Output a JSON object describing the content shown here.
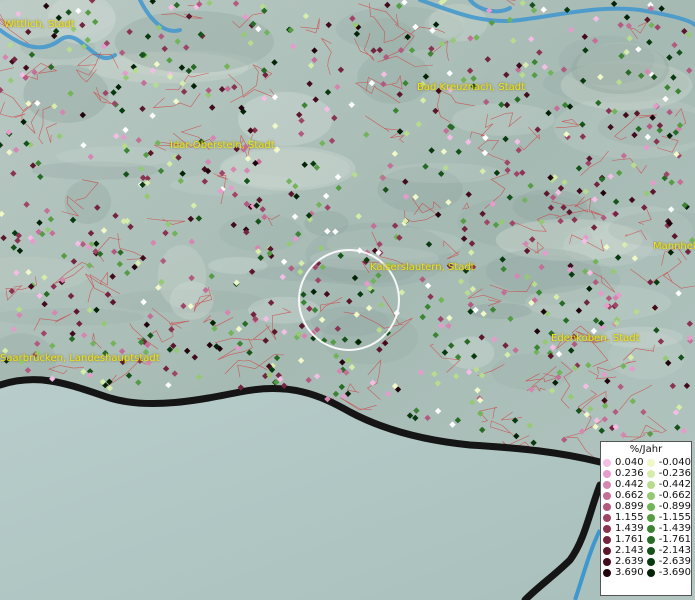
{
  "places": [
    {
      "name": "Wittlich, Stadt"
    },
    {
      "name": "Bad Kreuznach, Stadt"
    },
    {
      "name": "Idar-Oberstein, Stadt"
    },
    {
      "name": "Kaiserslautern, Stadt"
    },
    {
      "name": "Mannheim"
    },
    {
      "name": "Edenkoben, Stadt"
    },
    {
      "name": "Saarbrücken, Landeshauptstadt"
    }
  ],
  "legend": {
    "title": "%/Jahr",
    "positive": [
      {
        "label": "0.040",
        "color": "#f4bde4"
      },
      {
        "label": "0.236",
        "color": "#e59ccc"
      },
      {
        "label": "0.442",
        "color": "#d587b2"
      },
      {
        "label": "0.662",
        "color": "#c46f97"
      },
      {
        "label": "0.899",
        "color": "#b35a80"
      },
      {
        "label": "1.155",
        "color": "#9f4668"
      },
      {
        "label": "1.439",
        "color": "#8a3452"
      },
      {
        "label": "1.761",
        "color": "#73243e"
      },
      {
        "label": "2.143",
        "color": "#5c172c"
      },
      {
        "label": "2.639",
        "color": "#420c1c"
      },
      {
        "label": "3.690",
        "color": "#24040c"
      }
    ],
    "negative": [
      {
        "label": "-0.040",
        "color": "#f0f7c8"
      },
      {
        "label": "-0.236",
        "color": "#d6ecab"
      },
      {
        "label": "-0.442",
        "color": "#b7dc8e"
      },
      {
        "label": "-0.662",
        "color": "#95c974"
      },
      {
        "label": "-0.899",
        "color": "#73b35a"
      },
      {
        "label": "-1.155",
        "color": "#559c45"
      },
      {
        "label": "-1.439",
        "color": "#3c8434"
      },
      {
        "label": "-1.761",
        "color": "#276b27"
      },
      {
        "label": "-2.143",
        "color": "#16521a"
      },
      {
        "label": "-2.639",
        "color": "#093a0f"
      },
      {
        "label": "-3.690",
        "color": "#022306"
      }
    ]
  }
}
